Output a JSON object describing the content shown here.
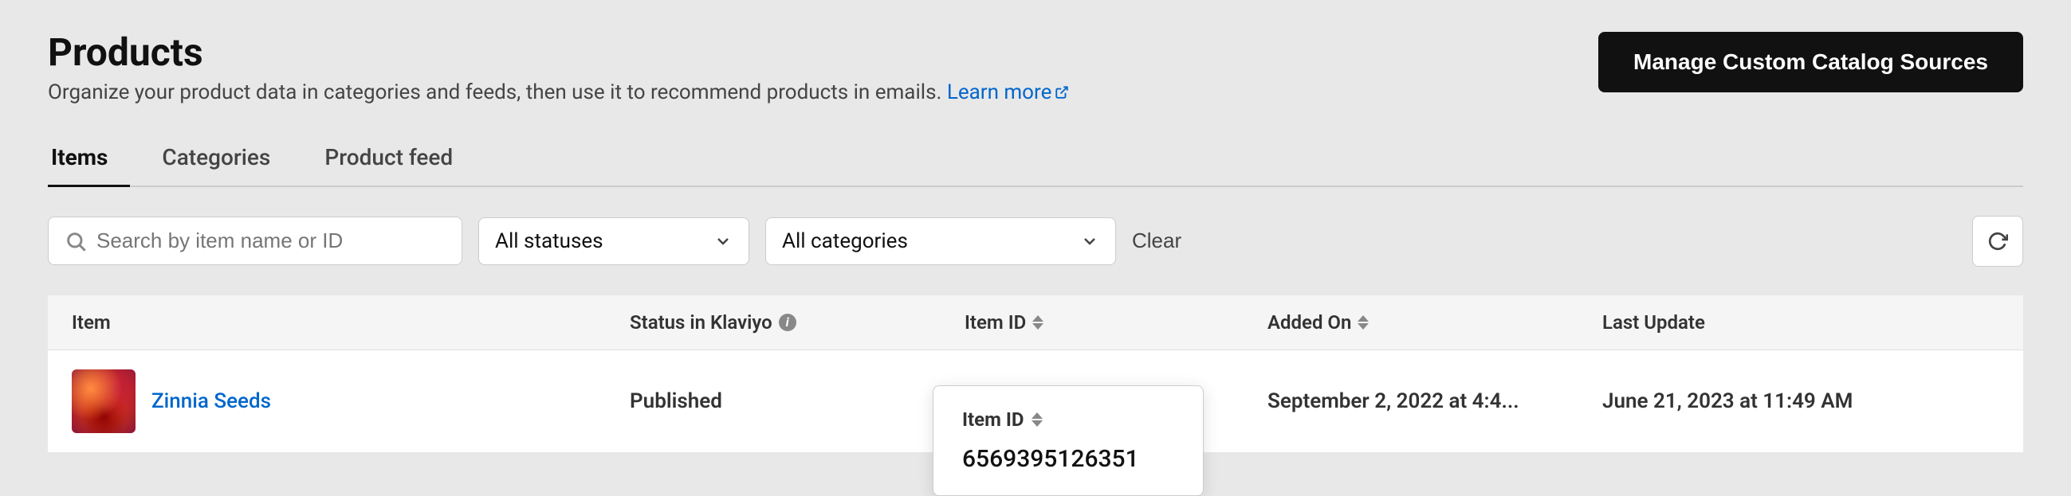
{
  "page": {
    "title": "Products",
    "subtitle": "Organize your product data in categories and feeds, then use it to recommend products in emails.",
    "learn_more_label": "Learn more",
    "manage_btn_label": "Manage Custom Catalog Sources"
  },
  "tabs": [
    {
      "id": "items",
      "label": "Items",
      "active": true
    },
    {
      "id": "categories",
      "label": "Categories",
      "active": false
    },
    {
      "id": "product-feed",
      "label": "Product feed",
      "active": false
    }
  ],
  "filters": {
    "search_placeholder": "Search by item name or ID",
    "statuses_label": "All statuses",
    "categories_label": "All categories",
    "clear_label": "Clear"
  },
  "table": {
    "columns": [
      {
        "id": "item",
        "label": "Item"
      },
      {
        "id": "status",
        "label": "Status in Klaviyo"
      },
      {
        "id": "itemid",
        "label": "Item ID"
      },
      {
        "id": "addedon",
        "label": "Added On"
      },
      {
        "id": "lastupdate",
        "label": "Last Update"
      }
    ],
    "rows": [
      {
        "id": "zinnia-seeds",
        "name": "Zinnia Seeds",
        "status": "Published",
        "item_id": "6569395126351",
        "added_on": "September 2, 2022 at 4:4...",
        "last_update": "June 21, 2023 at 11:49 AM"
      }
    ]
  },
  "itemid_popup": {
    "header": "Item ID",
    "value": "6569395126351"
  }
}
